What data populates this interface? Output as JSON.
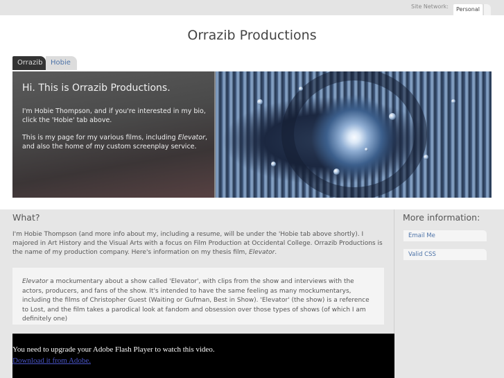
{
  "topbar": {
    "network_label": "Site Network:",
    "network_value": "Personal"
  },
  "site": {
    "title": "Orrazib Productions"
  },
  "tabs": [
    {
      "label": "Orrazib",
      "active": true
    },
    {
      "label": "Hobie",
      "active": false
    }
  ],
  "hero": {
    "heading": "Hi. This is Orrazib Productions.",
    "p1": "I'm Hobie Thompson, and if you're interested in my bio, click the 'Hobie' tab above.",
    "p2_pre": "This is my page for my various films, including ",
    "p2_em": "Elevator",
    "p2_post": ", and also the home of my custom screenplay service."
  },
  "main": {
    "heading": "What?",
    "intro_pre": "I'm Hobie Thompson (and more info about my, including a resume, will be under the 'Hobie tab above shortly). I majored in Art History and the Visual Arts with a focus on Film Production at Occidental College. Orrazib Productions is the name of my production company. Here's information on my thesis film, ",
    "intro_em": "Elevator",
    "intro_post": ".",
    "quote_em": "Elevator",
    "quote_text": " a mockumentary about a show called 'Elevator', with clips from the show and interviews with the actors, producers, and fans of the show. It's intended to have the same feeling as many mockumentarys, including the films of Christopher Guest (Waiting or Gufman, Best in Show). 'Elevator' (the show) is a reference to Lost, and the film takes a parodical look at fandom and obsession over those types of shows (of which I am definitely one)",
    "flash_message": "You need to upgrade your Adobe Flash Player to watch this video.",
    "flash_link": "Download it from Adobe."
  },
  "sidebar": {
    "heading": "More information:",
    "links": [
      {
        "label": "Email Me"
      },
      {
        "label": "Valid CSS"
      }
    ]
  }
}
